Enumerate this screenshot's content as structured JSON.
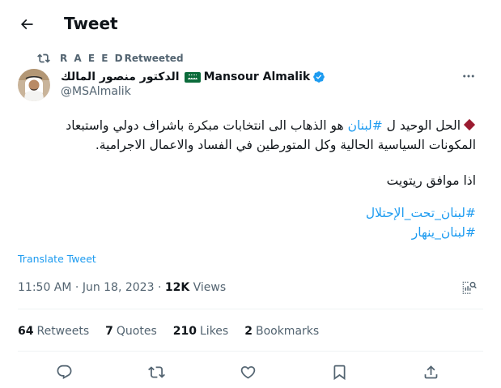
{
  "header": {
    "title": "Tweet"
  },
  "retweet": {
    "name": "R A E E D",
    "label": "Retweeted"
  },
  "author": {
    "arabic_name": "الدكتور منصور المالك",
    "name": "Mansour Almalik",
    "handle": "@MSAlmalik"
  },
  "tweet": {
    "line1_lead": "الحل الوحيد ل ",
    "line1_hashtag": "#لبنان",
    "line1_rest": " هو الذهاب الى انتخابات مبكرة باشراف دولي واستبعاد",
    "line2": "المكونات السياسية الحالية وكل المتورطين في الفساد والاعمال الاجرامية.",
    "line3": "اذا موافق ريتويت",
    "hashtag1": "#لبنان_تحت_الإحتلال",
    "hashtag2": "#لبنان_ينهار"
  },
  "translate_label": "Translate Tweet",
  "meta": {
    "time": "11:50 AM",
    "date": "Jun 18, 2023",
    "views_count": "12K",
    "views_label": "Views"
  },
  "stats": {
    "retweets_count": "64",
    "retweets_label": "Retweets",
    "quotes_count": "7",
    "quotes_label": "Quotes",
    "likes_count": "210",
    "likes_label": "Likes",
    "bookmarks_count": "2",
    "bookmarks_label": "Bookmarks"
  },
  "icons": {
    "back": "arrow-left-icon",
    "retweet": "retweet-icon",
    "verified": "verified-badge-icon",
    "flag": "saudi-flag-icon",
    "more": "more-dots-icon",
    "analytics": "analytics-icon",
    "reply": "reply-icon",
    "like": "heart-icon",
    "bookmark": "bookmark-icon",
    "share": "share-icon"
  },
  "colors": {
    "accent": "#1d9bf0",
    "text": "#0f1419",
    "secondary": "#536471",
    "diamond": "#9b1b30"
  }
}
